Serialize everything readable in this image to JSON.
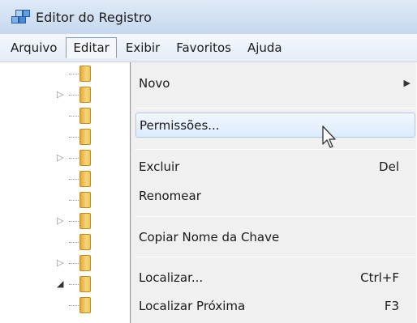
{
  "window": {
    "title": "Editor do Registro",
    "icon": "registry-editor-icon"
  },
  "menubar": {
    "items": [
      {
        "label": "Arquivo",
        "open": false
      },
      {
        "label": "Editar",
        "open": true
      },
      {
        "label": "Exibir",
        "open": false
      },
      {
        "label": "Favoritos",
        "open": false
      },
      {
        "label": "Ajuda",
        "open": false
      }
    ]
  },
  "edit_menu": {
    "items": [
      {
        "label": "Novo",
        "shortcut": "",
        "submenu": true,
        "highlighted": false
      },
      {
        "label": "Permissões...",
        "shortcut": "",
        "submenu": false,
        "highlighted": true
      },
      {
        "label": "Excluir",
        "shortcut": "Del",
        "submenu": false,
        "highlighted": false
      },
      {
        "label": "Renomear",
        "shortcut": "",
        "submenu": false,
        "highlighted": false
      },
      {
        "label": "Copiar Nome da Chave",
        "shortcut": "",
        "submenu": false,
        "highlighted": false
      },
      {
        "label": "Localizar...",
        "shortcut": "Ctrl+F",
        "submenu": false,
        "highlighted": false
      },
      {
        "label": "Localizar Próxima",
        "shortcut": "F3",
        "submenu": false,
        "highlighted": false
      }
    ]
  },
  "tree": {
    "rows": [
      {
        "expander": ""
      },
      {
        "expander": "collapsed"
      },
      {
        "expander": ""
      },
      {
        "expander": ""
      },
      {
        "expander": "collapsed"
      },
      {
        "expander": ""
      },
      {
        "expander": ""
      },
      {
        "expander": "collapsed"
      },
      {
        "expander": ""
      },
      {
        "expander": "collapsed"
      },
      {
        "expander": "expanded"
      },
      {
        "expander": ""
      }
    ]
  }
}
